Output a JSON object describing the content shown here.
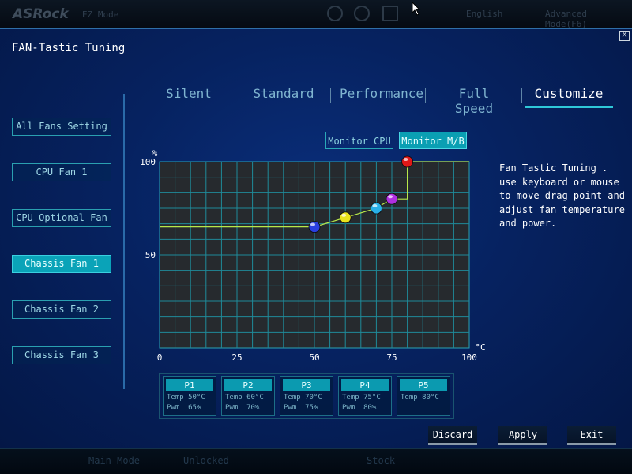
{
  "topbar": {
    "brand": "ASRock",
    "mode": "EZ Mode",
    "language": "English",
    "advanced": "Advanced Mode(F6)"
  },
  "bottombar": {
    "item1": "Main Mode",
    "item2": "Unlocked",
    "item3": "Stock"
  },
  "dialog": {
    "title": "FAN-Tastic Tuning",
    "close": "X"
  },
  "tabs": [
    {
      "label": "Silent"
    },
    {
      "label": "Standard"
    },
    {
      "label": "Performance"
    },
    {
      "label": "Full Speed"
    },
    {
      "label": "Customize"
    }
  ],
  "active_tab": "Customize",
  "fans": [
    {
      "label": "All Fans Setting"
    },
    {
      "label": "CPU Fan 1"
    },
    {
      "label": "CPU Optional Fan"
    },
    {
      "label": "Chassis Fan 1"
    },
    {
      "label": "Chassis Fan 2"
    },
    {
      "label": "Chassis Fan 3"
    }
  ],
  "active_fan": "Chassis Fan 1",
  "monitor": {
    "cpu": "Monitor CPU",
    "mb": "Monitor M/B",
    "active": "Monitor M/B"
  },
  "help_text": "Fan Tastic Tuning . use keyboard or mouse to move drag-point and adjust fan temperature and power.",
  "chart_data": {
    "type": "line",
    "y_unit": "%",
    "x_unit": "°C",
    "xlim": [
      0,
      100
    ],
    "ylim": [
      0,
      100
    ],
    "x_ticks": [
      0,
      25,
      50,
      75,
      100
    ],
    "y_ticks": [
      50,
      100
    ],
    "grid": true,
    "curve": [
      {
        "x": 0,
        "y": 65
      },
      {
        "x": 50,
        "y": 65
      },
      {
        "x": 60,
        "y": 70
      },
      {
        "x": 70,
        "y": 75
      },
      {
        "x": 75,
        "y": 80
      },
      {
        "x": 80,
        "y": 80
      },
      {
        "x": 80,
        "y": 100
      },
      {
        "x": 100,
        "y": 100
      }
    ],
    "points": [
      {
        "name": "P1",
        "temp": 50,
        "pwm": 65,
        "color": "#2a3fe0"
      },
      {
        "name": "P2",
        "temp": 60,
        "pwm": 70,
        "color": "#e8e21c"
      },
      {
        "name": "P3",
        "temp": 70,
        "pwm": 75,
        "color": "#28b0e8"
      },
      {
        "name": "P4",
        "temp": 75,
        "pwm": 80,
        "color": "#b02fe0"
      },
      {
        "name": "P5",
        "temp": 80,
        "pwm": 100,
        "color": "#e01818"
      }
    ],
    "line_color": "#b8e84a"
  },
  "point_table": [
    {
      "name": "P1",
      "temp": "Temp 50°C",
      "pwm": "Pwm  65%"
    },
    {
      "name": "P2",
      "temp": "Temp 60°C",
      "pwm": "Pwm  70%"
    },
    {
      "name": "P3",
      "temp": "Temp 70°C",
      "pwm": "Pwm  75%"
    },
    {
      "name": "P4",
      "temp": "Temp 75°C",
      "pwm": "Pwm  80%"
    },
    {
      "name": "P5",
      "temp": "Temp 80°C",
      "pwm": ""
    }
  ],
  "actions": {
    "discard": "Discard",
    "apply": "Apply",
    "exit": "Exit"
  }
}
